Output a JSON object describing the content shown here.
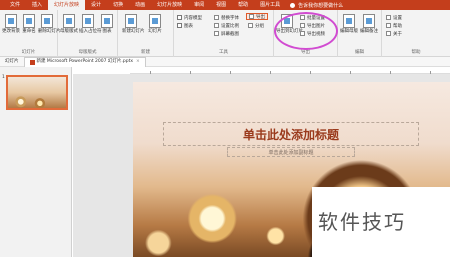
{
  "tabs": [
    {
      "label": "文件"
    },
    {
      "label": "插入"
    },
    {
      "label": "幻灯片放映"
    },
    {
      "label": "设计"
    },
    {
      "label": "切换"
    },
    {
      "label": "动画"
    },
    {
      "label": "幻灯片放映"
    },
    {
      "label": "审阅"
    },
    {
      "label": "视图"
    },
    {
      "label": "帮助"
    },
    {
      "label": "图片工具"
    }
  ],
  "active_tab_index": 2,
  "tell_me": "告诉我你想要做什么",
  "ribbon": {
    "g1": {
      "label": "幻灯片",
      "b1": "更改背景",
      "b2": "重命名",
      "b3": "删除幻灯片"
    },
    "g2": {
      "label": "母版版式",
      "b1": "母版版式",
      "b2": "插入占位符",
      "b3": "图表"
    },
    "g3": {
      "label": "新建",
      "b1": "新建幻灯片",
      "b2": "幻灯片"
    },
    "g4": {
      "label": "工具",
      "c1": "内容模型",
      "c2": "图表",
      "r1": "替换字体",
      "r2": "导出",
      "r3": "设置比例",
      "r4": "分组",
      "r5": "屏幕截图"
    },
    "g5": {
      "label": "导出",
      "big": "导出到幻灯片",
      "r1": "批量设置",
      "r2": "导出图片",
      "r3": "导出视频"
    },
    "g6": {
      "label": "编辑",
      "b1": "编辑母版",
      "b2": "编辑备注"
    },
    "g7": {
      "label": "帮助",
      "r1": "设置",
      "r2": "帮助",
      "r3": "关于"
    }
  },
  "docbar": {
    "pane_label": "幻灯片",
    "active_doc": "新建 Microsoft PowerPoint 2007 幻灯片.pptx"
  },
  "slide_panel": {
    "slide_number": "1"
  },
  "slide": {
    "title": "单击此处添加标题",
    "subtitle": "单击此处添加副标题"
  },
  "watermark": "软件技巧",
  "colors": {
    "accent": "#c43e1c",
    "highlight_circle": "#d14bd1",
    "title_text": "#9a3a1c"
  }
}
